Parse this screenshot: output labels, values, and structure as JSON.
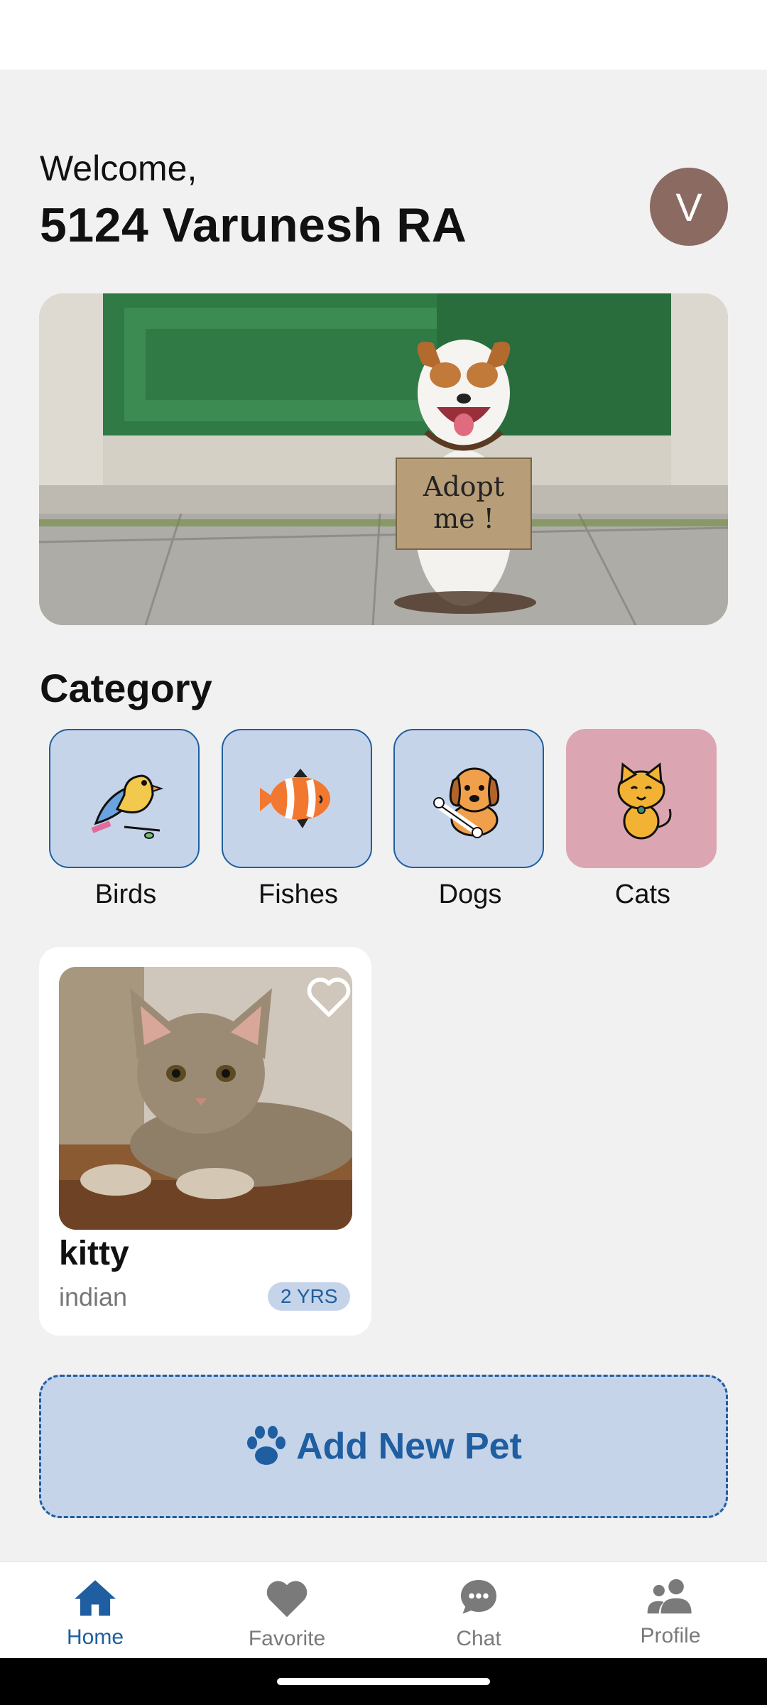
{
  "header": {
    "welcome": "Welcome,",
    "username": "5124 Varunesh RA",
    "avatar_initial": "V",
    "avatar_color": "#8b6a61"
  },
  "banner": {
    "sign_text": "Adopt me!"
  },
  "category": {
    "title": "Category",
    "items": [
      {
        "label": "Birds",
        "icon": "bird-icon",
        "selected": false
      },
      {
        "label": "Fishes",
        "icon": "clownfish-icon",
        "selected": false
      },
      {
        "label": "Dogs",
        "icon": "dog-icon",
        "selected": false
      },
      {
        "label": "Cats",
        "icon": "cat-icon",
        "selected": true
      }
    ]
  },
  "pets": [
    {
      "name": "kitty",
      "breed": "indian",
      "age": "2 YRS",
      "favorite": false
    }
  ],
  "add_pet": {
    "label": "Add New Pet",
    "icon": "paw-icon"
  },
  "bottom_nav": [
    {
      "label": "Home",
      "icon": "home-icon",
      "active": true
    },
    {
      "label": "Favorite",
      "icon": "heart-icon",
      "active": false
    },
    {
      "label": "Chat",
      "icon": "chat-icon",
      "active": false
    },
    {
      "label": "Profile",
      "icon": "people-icon",
      "active": false
    }
  ],
  "colors": {
    "primary": "#1f5ea0",
    "tile_bg": "#c6d4ea",
    "selected_tile_bg": "#dba6b2",
    "background": "#f1f1f1"
  }
}
